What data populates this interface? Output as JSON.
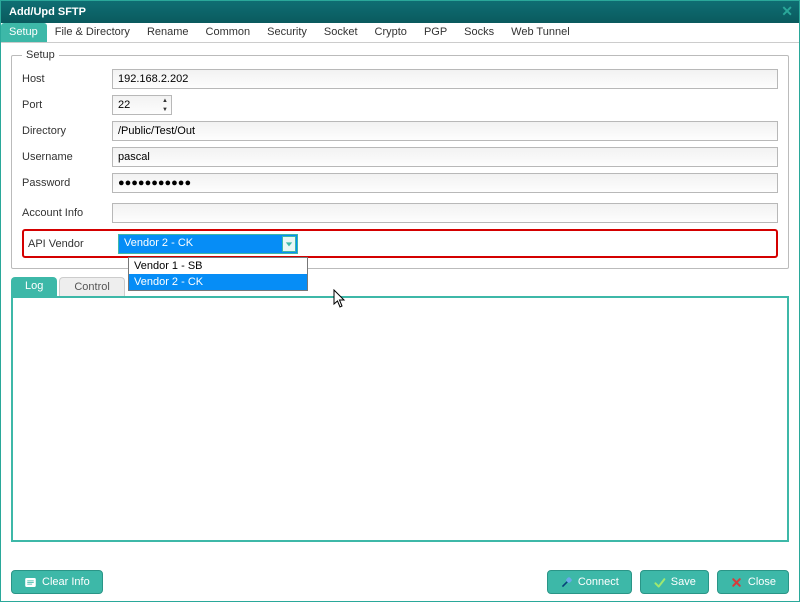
{
  "window": {
    "title": "Add/Upd SFTP"
  },
  "tabs": {
    "items": [
      "Setup",
      "File & Directory",
      "Rename",
      "Common",
      "Security",
      "Socket",
      "Crypto",
      "PGP",
      "Socks",
      "Web Tunnel"
    ],
    "active_index": 0
  },
  "setup": {
    "legend": "Setup",
    "labels": {
      "host": "Host",
      "port": "Port",
      "directory": "Directory",
      "username": "Username",
      "password": "Password",
      "account_info": "Account Info",
      "api_vendor": "API Vendor"
    },
    "values": {
      "host": "192.168.2.202",
      "port": "22",
      "directory": "/Public/Test/Out",
      "username": "pascal",
      "password": "●●●●●●●●●●●",
      "account_info": "",
      "api_vendor_selected": "Vendor 2 - CK"
    },
    "api_vendor_options": [
      "Vendor 1 - SB",
      "Vendor 2 - CK"
    ],
    "api_vendor_highlight_index": 1
  },
  "log_tabs": {
    "items": [
      "Log",
      "Control"
    ],
    "active_index": 0
  },
  "buttons": {
    "clear_info": "Clear Info",
    "connect": "Connect",
    "save": "Save",
    "close": "Close"
  }
}
